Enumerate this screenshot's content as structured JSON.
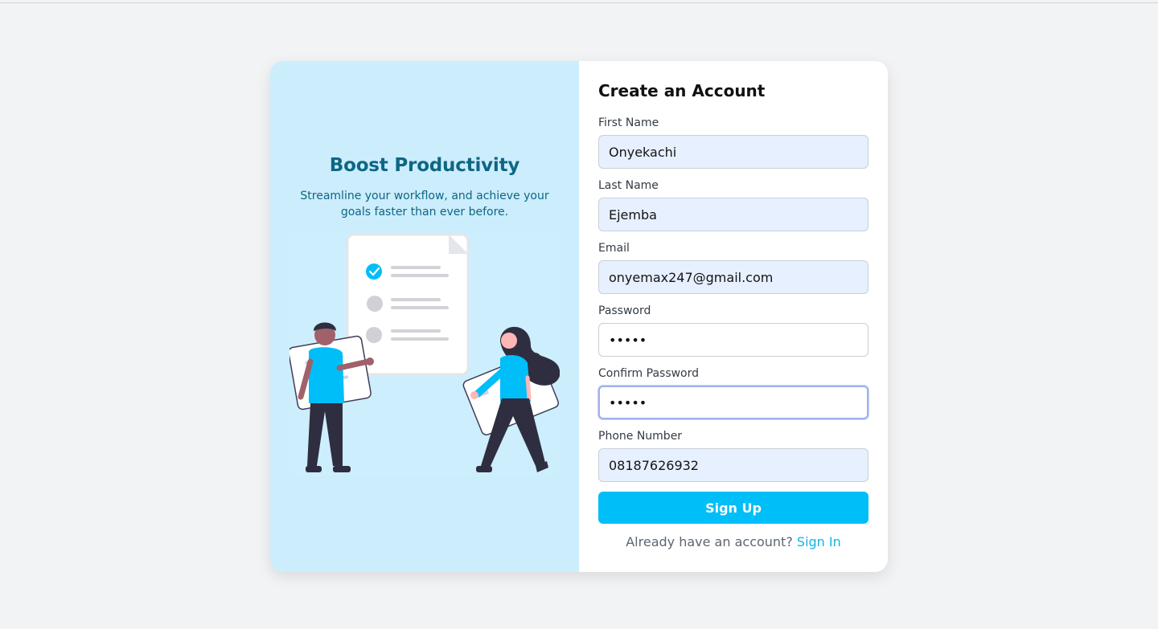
{
  "promo": {
    "title": "Boost Productivity",
    "subtitle": "Streamline your workflow, and achieve your goals faster than ever before."
  },
  "form": {
    "title": "Create an Account",
    "fields": {
      "first_name": {
        "label": "First Name",
        "value": "Onyekachi"
      },
      "last_name": {
        "label": "Last Name",
        "value": "Ejemba"
      },
      "email": {
        "label": "Email",
        "value": "onyemax247@gmail.com"
      },
      "password": {
        "label": "Password",
        "value": "•••••"
      },
      "confirm_password": {
        "label": "Confirm Password",
        "value": "•••••"
      },
      "phone": {
        "label": "Phone Number",
        "value": "08187626932"
      }
    },
    "submit_label": "Sign Up",
    "signin_prompt": "Already have an account?",
    "signin_link": "Sign In"
  },
  "colors": {
    "accent": "#00bef8",
    "promo_bg": "#ccedfc",
    "promo_text": "#0d6684",
    "page_bg": "#f2f3f5"
  }
}
